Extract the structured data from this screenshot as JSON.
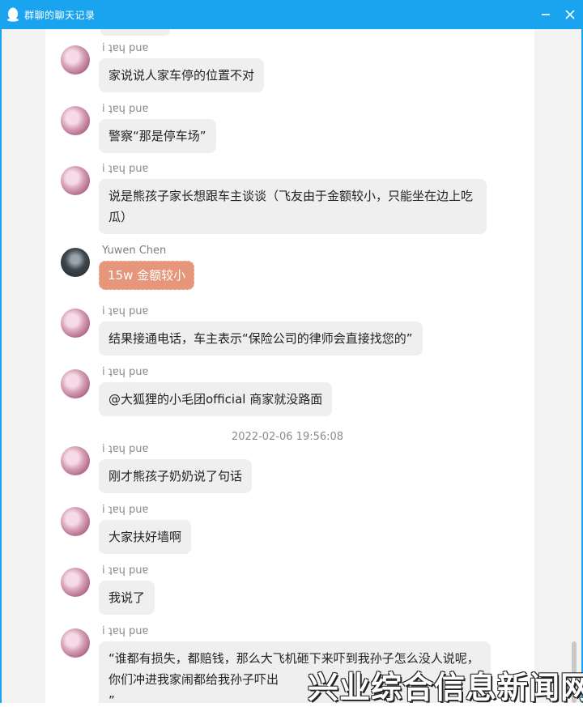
{
  "window": {
    "title": "群聊的聊天记录",
    "icon": "qq-penguin-icon"
  },
  "chat": {
    "messages": [
      {
        "sender": "i ʇɐɥ puɐ",
        "text": "家说说人家车停的位置不对",
        "avatar": "anime-avatar"
      },
      {
        "sender": "i ʇɐɥ puɐ",
        "text": "警察“那是停车场”",
        "avatar": "anime-avatar"
      },
      {
        "sender": "i ʇɐɥ puɐ",
        "text": "说是熊孩子家长想跟车主谈谈（飞友由于金额较小，只能坐在边上吃瓜）",
        "avatar": "anime-avatar"
      },
      {
        "sender": "Yuwen Chen",
        "text": "15w 金额较小",
        "avatar": "dark-avatar"
      },
      {
        "sender": "i ʇɐɥ puɐ",
        "text": "结果接通电话，车主表示“保险公司的律师会直接找您的”",
        "avatar": "anime-avatar"
      },
      {
        "sender": "i ʇɐɥ puɐ",
        "text": "@大狐狸的小毛团official 商家就没路面",
        "avatar": "anime-avatar"
      },
      {
        "sender": "i ʇɐɥ puɐ",
        "text": "刚才熊孩子奶奶说了句话",
        "avatar": "anime-avatar"
      },
      {
        "sender": "i ʇɐɥ puɐ",
        "text": "大家扶好墙啊",
        "avatar": "anime-avatar"
      },
      {
        "sender": "i ʇɐɥ puɐ",
        "text": "我说了",
        "avatar": "anime-avatar"
      },
      {
        "sender": "i ʇɐɥ puɐ",
        "text": "“谁都有损失，都赔钱，那么大飞机砸下来吓到我孙子怎么没人说呢，你们冲进我家闹都给我孙子吓出",
        "avatar": "anime-avatar"
      }
    ],
    "timestamp": "2022-02-06 19:56:08",
    "trailing_quote": "”"
  },
  "watermark": "兴业综合信息新闻网",
  "colors": {
    "titlebar": "#1aa3ef",
    "bubble": "#efefef",
    "accent_bubble": "#e6967a"
  }
}
